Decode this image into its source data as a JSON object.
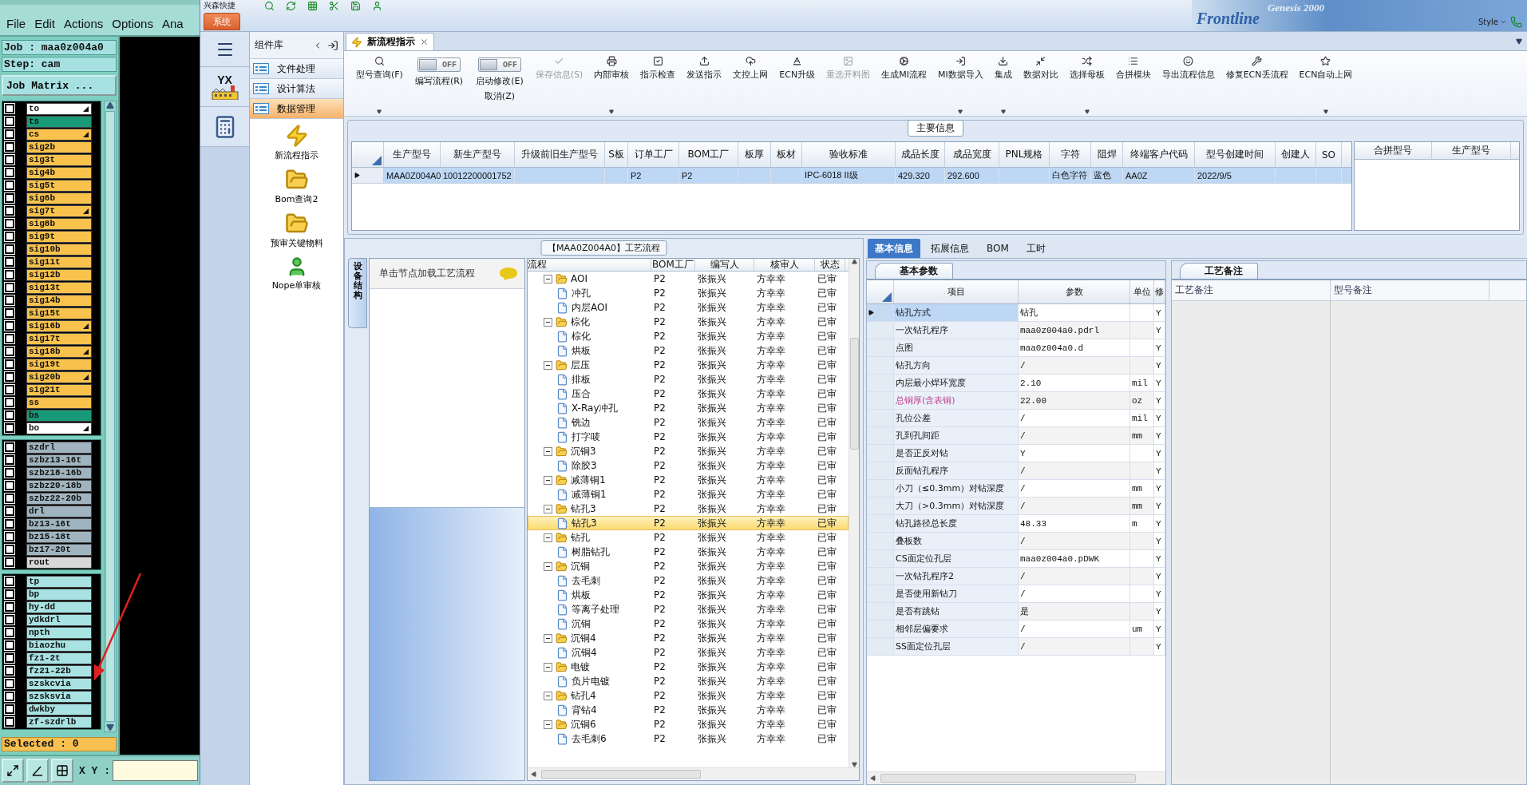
{
  "genesis": {
    "menu": [
      "File",
      "Edit",
      "Actions",
      "Options",
      "Ana"
    ],
    "job": "Job : maa0z004a0",
    "step": "Step: cam",
    "matrix_button": "Job Matrix ...",
    "layer_groups": [
      {
        "layers": [
          {
            "name": "to",
            "color": "#ffffff",
            "marked": true,
            "checked": false
          },
          {
            "name": "ts",
            "color": "#189a78",
            "marked": false,
            "checked": false
          },
          {
            "name": "cs",
            "color": "#f8c24c",
            "marked": true,
            "checked": false
          },
          {
            "name": "sig2b",
            "color": "#f8c24c",
            "marked": false,
            "checked": false
          },
          {
            "name": "sig3t",
            "color": "#f8c24c",
            "marked": false,
            "checked": false
          },
          {
            "name": "sig4b",
            "color": "#f8c24c",
            "marked": false,
            "checked": false
          },
          {
            "name": "sig5t",
            "color": "#f8c24c",
            "marked": false,
            "checked": false
          },
          {
            "name": "sig6b",
            "color": "#f8c24c",
            "marked": false,
            "checked": false
          },
          {
            "name": "sig7t",
            "color": "#f8c24c",
            "marked": true,
            "checked": false
          },
          {
            "name": "sig8b",
            "color": "#f8c24c",
            "marked": false,
            "checked": false
          },
          {
            "name": "sig9t",
            "color": "#f8c24c",
            "marked": false,
            "checked": false
          },
          {
            "name": "sig10b",
            "color": "#f8c24c",
            "marked": false,
            "checked": false
          },
          {
            "name": "sig11t",
            "color": "#f8c24c",
            "marked": false,
            "checked": false
          },
          {
            "name": "sig12b",
            "color": "#f8c24c",
            "marked": false,
            "checked": false
          },
          {
            "name": "sig13t",
            "color": "#f8c24c",
            "marked": false,
            "checked": false
          },
          {
            "name": "sig14b",
            "color": "#f8c24c",
            "marked": false,
            "checked": false
          },
          {
            "name": "sig15t",
            "color": "#f8c24c",
            "marked": false,
            "checked": false
          },
          {
            "name": "sig16b",
            "color": "#f8c24c",
            "marked": true,
            "checked": false
          },
          {
            "name": "sig17t",
            "color": "#f8c24c",
            "marked": false,
            "checked": false
          },
          {
            "name": "sig18b",
            "color": "#f8c24c",
            "marked": true,
            "checked": false
          },
          {
            "name": "sig19t",
            "color": "#f8c24c",
            "marked": false,
            "checked": false
          },
          {
            "name": "sig20b",
            "color": "#f8c24c",
            "marked": true,
            "checked": false
          },
          {
            "name": "sig21t",
            "color": "#f8c24c",
            "marked": false,
            "checked": false
          },
          {
            "name": "ss",
            "color": "#f8c24c",
            "marked": false,
            "checked": false
          },
          {
            "name": "bs",
            "color": "#189a78",
            "marked": false,
            "checked": false
          },
          {
            "name": "bo",
            "color": "#ffffff",
            "marked": true,
            "checked": false
          }
        ]
      },
      {
        "layers": [
          {
            "name": "szdrl",
            "color": "#9fb4be",
            "marked": false,
            "checked": false
          },
          {
            "name": "szbz13-16t",
            "color": "#9fb4be",
            "marked": false,
            "checked": false
          },
          {
            "name": "szbz18-16b",
            "color": "#9fb4be",
            "marked": false,
            "checked": false
          },
          {
            "name": "szbz20-18b",
            "color": "#9fb4be",
            "marked": false,
            "checked": false
          },
          {
            "name": "szbz22-20b",
            "color": "#9fb4be",
            "marked": false,
            "checked": false
          },
          {
            "name": "drl",
            "color": "#9fb4be",
            "marked": false,
            "checked": false
          },
          {
            "name": "bz13-16t",
            "color": "#9fb4be",
            "marked": false,
            "checked": false
          },
          {
            "name": "bz15-18t",
            "color": "#9fb4be",
            "marked": false,
            "checked": false
          },
          {
            "name": "bz17-20t",
            "color": "#9fb4be",
            "marked": false,
            "checked": false
          },
          {
            "name": "rout",
            "color": "#d8d8d8",
            "marked": false,
            "checked": false
          }
        ]
      },
      {
        "layers": [
          {
            "name": "tp",
            "color": "#a8e2e2",
            "marked": false,
            "checked": false
          },
          {
            "name": "bp",
            "color": "#a8e2e2",
            "marked": false,
            "checked": false
          },
          {
            "name": "hy-dd",
            "color": "#a8e2e2",
            "marked": false,
            "checked": false
          },
          {
            "name": "ydkdrl",
            "color": "#a8e2e2",
            "marked": false,
            "checked": false
          },
          {
            "name": "npth",
            "color": "#a8e2e2",
            "marked": false,
            "checked": false
          },
          {
            "name": "biaozhu",
            "color": "#a8e2e2",
            "marked": false,
            "checked": false
          },
          {
            "name": "fz1-2t",
            "color": "#a8e2e2",
            "marked": false,
            "checked": false
          },
          {
            "name": "fz21-22b",
            "color": "#a8e2e2",
            "marked": false,
            "checked": false
          },
          {
            "name": "szskcvia",
            "color": "#a8e2e2",
            "marked": false,
            "checked": false
          },
          {
            "name": "szsksvia",
            "color": "#a8e2e2",
            "marked": false,
            "checked": false
          },
          {
            "name": "dwkby",
            "color": "#a8e2e2",
            "marked": false,
            "checked": false
          },
          {
            "name": "zf-szdrlb",
            "color": "#a8e2e2",
            "marked": false,
            "checked": false
          }
        ]
      }
    ],
    "selected_count": "Selected : 0",
    "xy_label": "X Y :"
  },
  "app": {
    "title": "兴森快捷",
    "system_tab": "系统",
    "banner": [
      "Frontline",
      "Genesis 2000"
    ],
    "style_label": "Style",
    "rail_logo": "YX",
    "library": {
      "title": "组件库",
      "sections": [
        {
          "label": "文件处理",
          "selected": false
        },
        {
          "label": "设计算法",
          "selected": false
        },
        {
          "label": "数据管理",
          "selected": true
        }
      ],
      "tools": [
        {
          "label": "新流程指示"
        },
        {
          "label": "Bom查询2"
        },
        {
          "label": "预审关键物料"
        },
        {
          "label": "Nope单审核"
        }
      ]
    },
    "tabs": [
      {
        "label": "新流程指示",
        "selected": true
      }
    ],
    "toolbar": [
      {
        "kind": "button",
        "label": "型号查询(F)",
        "dropdown": true,
        "disabled": false
      },
      {
        "kind": "toggle",
        "label": "编写流程(R)",
        "toggle_text": "OFF",
        "on": false
      },
      {
        "kind": "toggle",
        "label": "启动修改(E)",
        "sublabel": "取消(Z)",
        "toggle_text": "OFF",
        "on": false
      },
      {
        "kind": "button",
        "label": "保存信息(S)",
        "dropdown": false,
        "disabled": true
      },
      {
        "kind": "button",
        "label": "内部审核",
        "dropdown": true,
        "disabled": false
      },
      {
        "kind": "button",
        "label": "指示检查",
        "dropdown": false,
        "disabled": false
      },
      {
        "kind": "button",
        "label": "发送指示",
        "dropdown": false,
        "disabled": false
      },
      {
        "kind": "button",
        "label": "文控上网",
        "dropdown": false,
        "disabled": false
      },
      {
        "kind": "button",
        "label": "ECN升级",
        "dropdown": false,
        "disabled": false
      },
      {
        "kind": "button",
        "label": "重选开料图",
        "dropdown": false,
        "disabled": true
      },
      {
        "kind": "button",
        "label": "生成MI流程",
        "dropdown": false,
        "disabled": false
      },
      {
        "kind": "button",
        "label": "MI数据导入",
        "dropdown": true,
        "disabled": false
      },
      {
        "kind": "button",
        "label": "集成",
        "dropdown": true,
        "disabled": false
      },
      {
        "kind": "button",
        "label": "数据对比",
        "dropdown": false,
        "disabled": false
      },
      {
        "kind": "button",
        "label": "选择母板",
        "dropdown": true,
        "disabled": false
      },
      {
        "kind": "button",
        "label": "合拼模块",
        "dropdown": false,
        "disabled": false
      },
      {
        "kind": "button",
        "label": "导出流程信息",
        "dropdown": false,
        "disabled": false
      },
      {
        "kind": "button",
        "label": "修复ECN丢流程",
        "dropdown": false,
        "disabled": false
      },
      {
        "kind": "button",
        "label": "ECN自动上网",
        "dropdown": true,
        "disabled": false
      }
    ],
    "main_info": {
      "title": "主要信息",
      "columns": [
        "生产型号",
        "新生产型号",
        "升级前旧生产型号",
        "S板",
        "订单工厂",
        "BOM工厂",
        "板厚",
        "板材",
        "验收标准",
        "成品长度",
        "成品宽度",
        "PNL规格",
        "字符",
        "阻焊",
        "终端客户代码",
        "型号创建时间",
        "创建人",
        "SO"
      ],
      "rows": [
        {
          "selected": true,
          "cells": [
            "MAA0Z004A0",
            "10012200001752",
            null,
            null,
            "P2",
            "P2",
            null,
            null,
            "IPC-6018 II级",
            "429.320",
            "292.600",
            null,
            "白色字符",
            "蓝色",
            "AA0Z",
            "2022/9/5",
            null,
            null
          ]
        }
      ],
      "side_columns": [
        "合拼型号",
        "生产型号"
      ]
    },
    "process": {
      "title": "【MAA0Z004A0】工艺流程",
      "side_tab": "设备结构",
      "hint": "单击节点加载工艺流程",
      "columns": [
        "流程",
        "BOM工厂",
        "编写人",
        "核审人",
        "状态"
      ],
      "nodes": [
        {
          "label": "AOI",
          "cells": [
            "P2",
            "张振兴",
            "方幸幸",
            "已审"
          ],
          "selected": false,
          "expanded": true,
          "children": [
            {
              "label": "冲孔",
              "cells": [
                "P2",
                "张振兴",
                "方幸幸",
                "已审"
              ],
              "selected": false
            },
            {
              "label": "内层AOI",
              "cells": [
                "P2",
                "张振兴",
                "方幸幸",
                "已审"
              ],
              "selected": false
            }
          ]
        },
        {
          "label": "棕化",
          "cells": [
            "P2",
            "张振兴",
            "方幸幸",
            "已审"
          ],
          "selected": false,
          "expanded": true,
          "children": [
            {
              "label": "棕化",
              "cells": [
                "P2",
                "张振兴",
                "方幸幸",
                "已审"
              ],
              "selected": false
            },
            {
              "label": "烘板",
              "cells": [
                "P2",
                "张振兴",
                "方幸幸",
                "已审"
              ],
              "selected": false
            }
          ]
        },
        {
          "label": "层压",
          "cells": [
            "P2",
            "张振兴",
            "方幸幸",
            "已审"
          ],
          "selected": false,
          "expanded": true,
          "children": [
            {
              "label": "排板",
              "cells": [
                "P2",
                "张振兴",
                "方幸幸",
                "已审"
              ],
              "selected": false
            },
            {
              "label": "压合",
              "cells": [
                "P2",
                "张振兴",
                "方幸幸",
                "已审"
              ],
              "selected": false
            },
            {
              "label": "X-Ray冲孔",
              "cells": [
                "P2",
                "张振兴",
                "方幸幸",
                "已审"
              ],
              "selected": false
            },
            {
              "label": "铣边",
              "cells": [
                "P2",
                "张振兴",
                "方幸幸",
                "已审"
              ],
              "selected": false
            },
            {
              "label": "打字唛",
              "cells": [
                "P2",
                "张振兴",
                "方幸幸",
                "已审"
              ],
              "selected": false
            }
          ]
        },
        {
          "label": "沉铜3",
          "cells": [
            "P2",
            "张振兴",
            "方幸幸",
            "已审"
          ],
          "selected": false,
          "expanded": true,
          "children": [
            {
              "label": "除胶3",
              "cells": [
                "P2",
                "张振兴",
                "方幸幸",
                "已审"
              ],
              "selected": false
            }
          ]
        },
        {
          "label": "减薄铜1",
          "cells": [
            "P2",
            "张振兴",
            "方幸幸",
            "已审"
          ],
          "selected": false,
          "expanded": true,
          "children": [
            {
              "label": "减薄铜1",
              "cells": [
                "P2",
                "张振兴",
                "方幸幸",
                "已审"
              ],
              "selected": false
            }
          ]
        },
        {
          "label": "钻孔3",
          "cells": [
            "P2",
            "张振兴",
            "方幸幸",
            "已审"
          ],
          "selected": false,
          "expanded": true,
          "children": [
            {
              "label": "钻孔3",
              "cells": [
                "P2",
                "张振兴",
                "方幸幸",
                "已审"
              ],
              "selected": true
            }
          ]
        },
        {
          "label": "钻孔",
          "cells": [
            "P2",
            "张振兴",
            "方幸幸",
            "已审"
          ],
          "selected": false,
          "expanded": true,
          "children": [
            {
              "label": "树脂钻孔",
              "cells": [
                "P2",
                "张振兴",
                "方幸幸",
                "已审"
              ],
              "selected": false
            }
          ]
        },
        {
          "label": "沉铜",
          "cells": [
            "P2",
            "张振兴",
            "方幸幸",
            "已审"
          ],
          "selected": false,
          "expanded": true,
          "children": [
            {
              "label": "去毛刺",
              "cells": [
                "P2",
                "张振兴",
                "方幸幸",
                "已审"
              ],
              "selected": false
            },
            {
              "label": "烘板",
              "cells": [
                "P2",
                "张振兴",
                "方幸幸",
                "已审"
              ],
              "selected": false
            },
            {
              "label": "等离子处理",
              "cells": [
                "P2",
                "张振兴",
                "方幸幸",
                "已审"
              ],
              "selected": false
            },
            {
              "label": "沉铜",
              "cells": [
                "P2",
                "张振兴",
                "方幸幸",
                "已审"
              ],
              "selected": false
            }
          ]
        },
        {
          "label": "沉铜4",
          "cells": [
            "P2",
            "张振兴",
            "方幸幸",
            "已审"
          ],
          "selected": false,
          "expanded": true,
          "children": [
            {
              "label": "沉铜4",
              "cells": [
                "P2",
                "张振兴",
                "方幸幸",
                "已审"
              ],
              "selected": false
            }
          ]
        },
        {
          "label": "电镀",
          "cells": [
            "P2",
            "张振兴",
            "方幸幸",
            "已审"
          ],
          "selected": false,
          "expanded": true,
          "children": [
            {
              "label": "负片电镀",
              "cells": [
                "P2",
                "张振兴",
                "方幸幸",
                "已审"
              ],
              "selected": false
            }
          ]
        },
        {
          "label": "钻孔4",
          "cells": [
            "P2",
            "张振兴",
            "方幸幸",
            "已审"
          ],
          "selected": false,
          "expanded": true,
          "children": [
            {
              "label": "背钻4",
              "cells": [
                "P2",
                "张振兴",
                "方幸幸",
                "已审"
              ],
              "selected": false
            }
          ]
        },
        {
          "label": "沉铜6",
          "cells": [
            "P2",
            "张振兴",
            "方幸幸",
            "已审"
          ],
          "selected": false,
          "expanded": true,
          "children": [
            {
              "label": "去毛刺6",
              "cells": [
                "P2",
                "张振兴",
                "方幸幸",
                "已审"
              ],
              "selected": false
            }
          ]
        }
      ]
    },
    "detail": {
      "tabs": [
        {
          "label": "基本信息",
          "selected": true
        },
        {
          "label": "拓展信息",
          "selected": false
        },
        {
          "label": "BOM",
          "selected": false
        },
        {
          "label": "工时",
          "selected": false
        }
      ],
      "param_tab": "基本参数",
      "param_columns": [
        "项目",
        "参数",
        "单位",
        "修"
      ],
      "params": [
        {
          "item": "钻孔方式",
          "value": "钻孔",
          "modified": "Y",
          "selected": true,
          "flagged": false
        },
        {
          "item": "一次钻孔程序",
          "value": "maa0z004a0.pdrl",
          "modified": "Y",
          "selected": false,
          "flagged": false
        },
        {
          "item": "点图",
          "value": "maa0z004a0.d",
          "modified": "Y",
          "selected": false,
          "flagged": false
        },
        {
          "item": "钻孔方向",
          "value": "/",
          "modified": "Y",
          "selected": false,
          "flagged": false
        },
        {
          "item": "内层最小焊环宽度",
          "value": "2.10",
          "unit": "mil",
          "modified": "Y",
          "selected": false,
          "flagged": false
        },
        {
          "item": "总铜厚(含表铜)",
          "value": "22.00",
          "unit": "oz",
          "modified": "Y",
          "selected": false,
          "flagged": true
        },
        {
          "item": "孔位公差",
          "value": "/",
          "unit": "mil",
          "modified": "Y",
          "selected": false,
          "flagged": false
        },
        {
          "item": "孔到孔间距",
          "value": "/",
          "unit": "mm",
          "modified": "Y",
          "selected": false,
          "flagged": false
        },
        {
          "item": "是否正反对钻",
          "value": "Y",
          "modified": "Y",
          "selected": false,
          "flagged": false
        },
        {
          "item": "反面钻孔程序",
          "value": "/",
          "modified": "Y",
          "selected": false,
          "flagged": false
        },
        {
          "item": "小刀（≤0.3mm）对钻深度",
          "value": "/",
          "unit": "mm",
          "modified": "Y",
          "selected": false,
          "flagged": false
        },
        {
          "item": "大刀（>0.3mm）对钻深度",
          "value": "/",
          "unit": "mm",
          "modified": "Y",
          "selected": false,
          "flagged": false
        },
        {
          "item": "钻孔路径总长度",
          "value": "48.33",
          "unit": "m",
          "modified": "Y",
          "selected": false,
          "flagged": false
        },
        {
          "item": "叠板数",
          "value": "/",
          "modified": "Y",
          "selected": false,
          "flagged": false
        },
        {
          "item": "CS面定位孔层",
          "value": "maa0z004a0.pDWK",
          "modified": "Y",
          "selected": false,
          "flagged": false
        },
        {
          "item": "一次钻孔程序2",
          "value": "/",
          "modified": "Y",
          "selected": false,
          "flagged": false
        },
        {
          "item": "是否使用新钻刀",
          "value": "/",
          "modified": "Y",
          "selected": false,
          "flagged": false
        },
        {
          "item": "是否有跳钻",
          "value": "是",
          "modified": "Y",
          "selected": false,
          "flagged": false
        },
        {
          "item": "相邻层偏要求",
          "value": "/",
          "unit": "um",
          "modified": "Y",
          "selected": false,
          "flagged": false
        },
        {
          "item": "SS面定位孔层",
          "value": "/",
          "modified": "Y",
          "selected": false,
          "flagged": false
        }
      ],
      "notes_tab": "工艺备注",
      "notes_columns": [
        "工艺备注",
        "型号备注"
      ]
    }
  }
}
